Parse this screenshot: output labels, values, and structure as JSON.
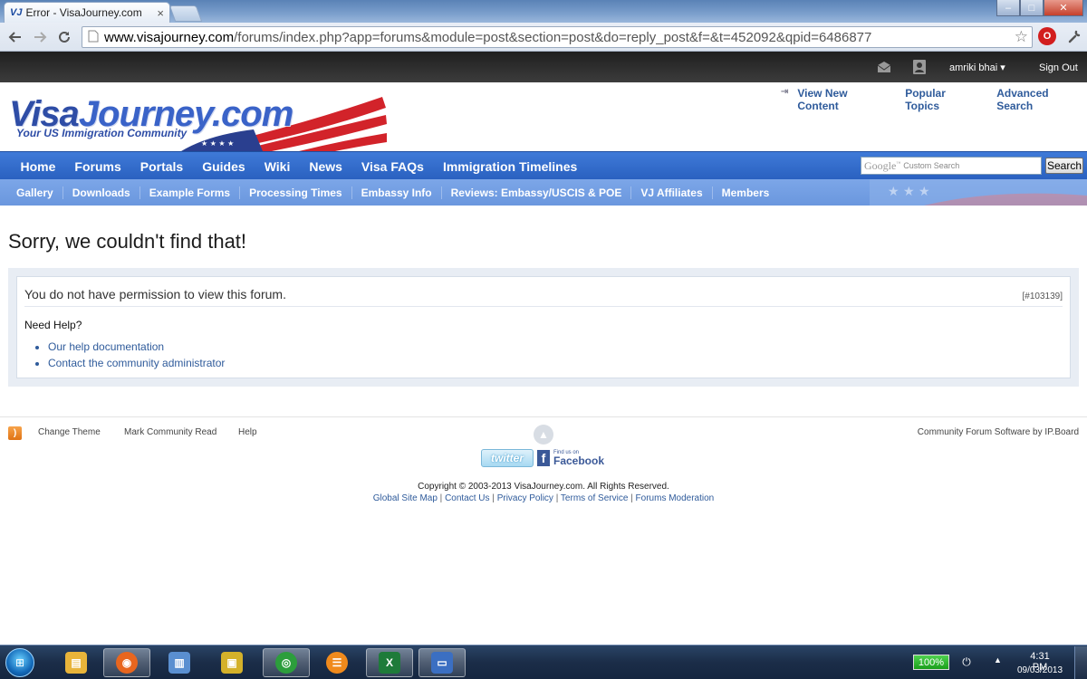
{
  "browser": {
    "tab_title": "Error - VisaJourney.com",
    "tab_favicon": "VJ",
    "tab_close": "×",
    "url_host": "www.visajourney.com",
    "url_rest": "/forums/index.php?app=forums&module=post&section=post&do=reply_post&f=&t=452092&qpid=6486877",
    "opera_icon": "O",
    "icons": {
      "back": "back-arrow-icon",
      "forward": "forward-arrow-icon",
      "reload": "reload-icon",
      "page": "page-icon",
      "star": "bookmark-star-icon",
      "wrench": "wrench-icon"
    }
  },
  "window": {
    "minimize": "‒",
    "maximize": "□",
    "close": "✕"
  },
  "userbar": {
    "username": "amriki bhai",
    "username_caret": "▾",
    "signout": "Sign Out"
  },
  "header": {
    "logo_part1": "Visa",
    "logo_part2": "Journey.com",
    "tagline": "Your US Immigration Community",
    "quick_links": [
      "View New Content",
      "Popular Topics",
      "Advanced Search"
    ]
  },
  "primary_nav": [
    "Home",
    "Forums",
    "Portals",
    "Guides",
    "Wiki",
    "News",
    "Visa FAQs",
    "Immigration Timelines"
  ],
  "search": {
    "google": "Google",
    "google_tm": "™",
    "placeholder": "Custom Search",
    "button": "Search"
  },
  "secondary_nav": [
    "Gallery",
    "Downloads",
    "Example Forms",
    "Processing Times",
    "Embassy Info",
    "Reviews: Embassy/USCIS & POE",
    "VJ Affiliates",
    "Members"
  ],
  "content": {
    "title": "Sorry, we couldn't find that!",
    "error_message": "You do not have permission to view this forum.",
    "error_code": "[#103139]",
    "need_help": "Need Help?",
    "help_links": [
      "Our help documentation",
      "Contact the community administrator"
    ]
  },
  "footer": {
    "links": [
      "Change Theme",
      "Mark Community Read",
      "Help"
    ],
    "powered": "Community Forum Software by IP.Board",
    "rss_glyph": ")",
    "totop_glyph": "▲",
    "twitter": "twitter",
    "fb_letter": "f",
    "fb_small": "Find us on",
    "fb_big": "Facebook",
    "copyright": "Copyright © 2003-2013 VisaJourney.com. All Rights Reserved.",
    "bottom_links": [
      "Global Site Map",
      "Contact Us",
      "Privacy Policy",
      "Terms of Service",
      "Forums Moderation"
    ]
  },
  "taskbar": {
    "battery": "100%",
    "time": "4:31 PM",
    "date": "09/03/2013",
    "apps": [
      {
        "name": "explorer-icon",
        "glyph": "▤",
        "color": "#e8b43a"
      },
      {
        "name": "firefox-icon",
        "glyph": "◉",
        "color": "#e8661e"
      },
      {
        "name": "book-icon",
        "glyph": "▥",
        "color": "#5a8fd0"
      },
      {
        "name": "lock-icon",
        "glyph": "▣",
        "color": "#d4b12a"
      },
      {
        "name": "chrome-icon",
        "glyph": "◎",
        "color": "#2c9e3c"
      },
      {
        "name": "app-icon",
        "glyph": "☰",
        "color": "#f08a1c"
      },
      {
        "name": "excel-icon",
        "glyph": "X",
        "color": "#1e7b3a"
      },
      {
        "name": "remote-desktop-icon",
        "glyph": "▭",
        "color": "#3b6fc2"
      }
    ]
  },
  "colors": {
    "nav_primary": "#2f6ccc",
    "nav_secondary": "#739fe3",
    "link": "#2f5b9b"
  }
}
